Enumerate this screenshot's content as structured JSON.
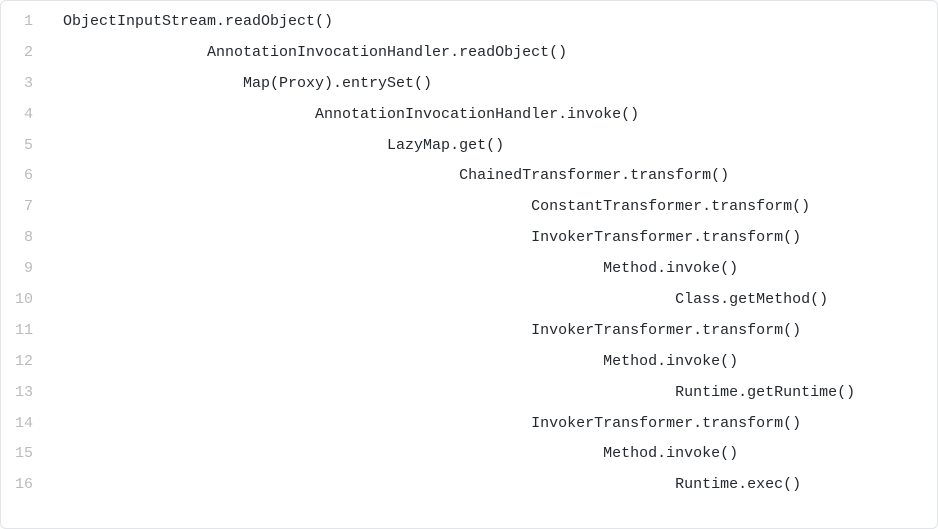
{
  "code": {
    "lines": [
      {
        "num": "1",
        "indent": 0,
        "text": "ObjectInputStream.readObject()"
      },
      {
        "num": "2",
        "indent": 16,
        "text": "AnnotationInvocationHandler.readObject()"
      },
      {
        "num": "3",
        "indent": 20,
        "text": "Map(Proxy).entrySet()"
      },
      {
        "num": "4",
        "indent": 28,
        "text": "AnnotationInvocationHandler.invoke()"
      },
      {
        "num": "5",
        "indent": 36,
        "text": "LazyMap.get()"
      },
      {
        "num": "6",
        "indent": 44,
        "text": "ChainedTransformer.transform()"
      },
      {
        "num": "7",
        "indent": 52,
        "text": "ConstantTransformer.transform()"
      },
      {
        "num": "8",
        "indent": 52,
        "text": "InvokerTransformer.transform()"
      },
      {
        "num": "9",
        "indent": 60,
        "text": "Method.invoke()"
      },
      {
        "num": "10",
        "indent": 68,
        "text": "Class.getMethod()"
      },
      {
        "num": "11",
        "indent": 52,
        "text": "InvokerTransformer.transform()"
      },
      {
        "num": "12",
        "indent": 60,
        "text": "Method.invoke()"
      },
      {
        "num": "13",
        "indent": 68,
        "text": "Runtime.getRuntime()"
      },
      {
        "num": "14",
        "indent": 52,
        "text": "InvokerTransformer.transform()"
      },
      {
        "num": "15",
        "indent": 60,
        "text": "Method.invoke()"
      },
      {
        "num": "16",
        "indent": 68,
        "text": "Runtime.exec()"
      }
    ]
  }
}
